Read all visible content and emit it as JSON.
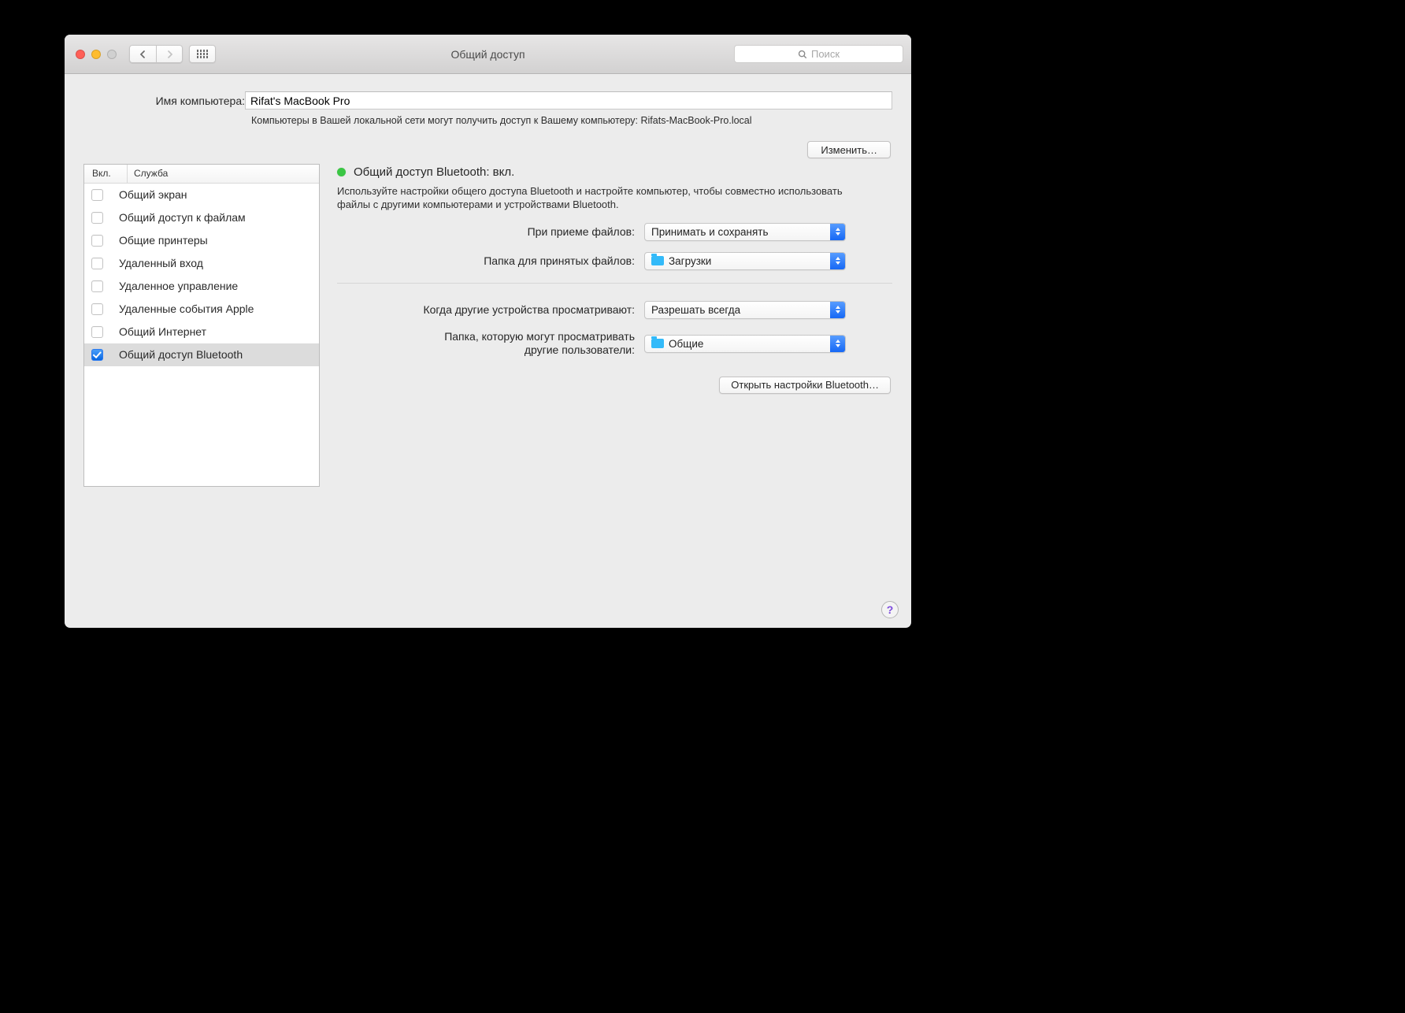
{
  "window": {
    "title": "Общий доступ",
    "search_placeholder": "Поиск"
  },
  "header": {
    "computer_name_label": "Имя компьютера:",
    "computer_name_value": "Rifat's MacBook Pro",
    "subtext": "Компьютеры в Вашей локальной сети могут получить доступ к Вашему компьютеру: Rifats-MacBook-Pro.local",
    "edit_button": "Изменить…"
  },
  "services": {
    "col_on": "Вкл.",
    "col_service": "Служба",
    "items": [
      {
        "checked": false,
        "label": "Общий экран"
      },
      {
        "checked": false,
        "label": "Общий доступ к файлам"
      },
      {
        "checked": false,
        "label": "Общие принтеры"
      },
      {
        "checked": false,
        "label": "Удаленный вход"
      },
      {
        "checked": false,
        "label": "Удаленное управление"
      },
      {
        "checked": false,
        "label": "Удаленные события Apple"
      },
      {
        "checked": false,
        "label": "Общий Интернет"
      },
      {
        "checked": true,
        "label": "Общий доступ Bluetooth"
      }
    ],
    "selected_index": 7
  },
  "detail": {
    "status_title": "Общий доступ Bluetooth: вкл.",
    "description": "Используйте настройки общего доступа Bluetooth и настройте компьютер, чтобы совместно использовать файлы с другими компьютерами и устройствами Bluetooth.",
    "row_receive_label": "При приеме файлов:",
    "row_receive_value": "Принимать и сохранять",
    "row_folder_label": "Папка для принятых файлов:",
    "row_folder_value": "Загрузки",
    "row_browse_label": "Когда другие устройства просматривают:",
    "row_browse_value": "Разрешать всегда",
    "row_share_folder_label_l1": "Папка, которую могут просматривать",
    "row_share_folder_label_l2": "другие пользователи:",
    "row_share_folder_value": "Общие",
    "open_bt_button": "Открыть настройки Bluetooth…"
  },
  "help_char": "?"
}
